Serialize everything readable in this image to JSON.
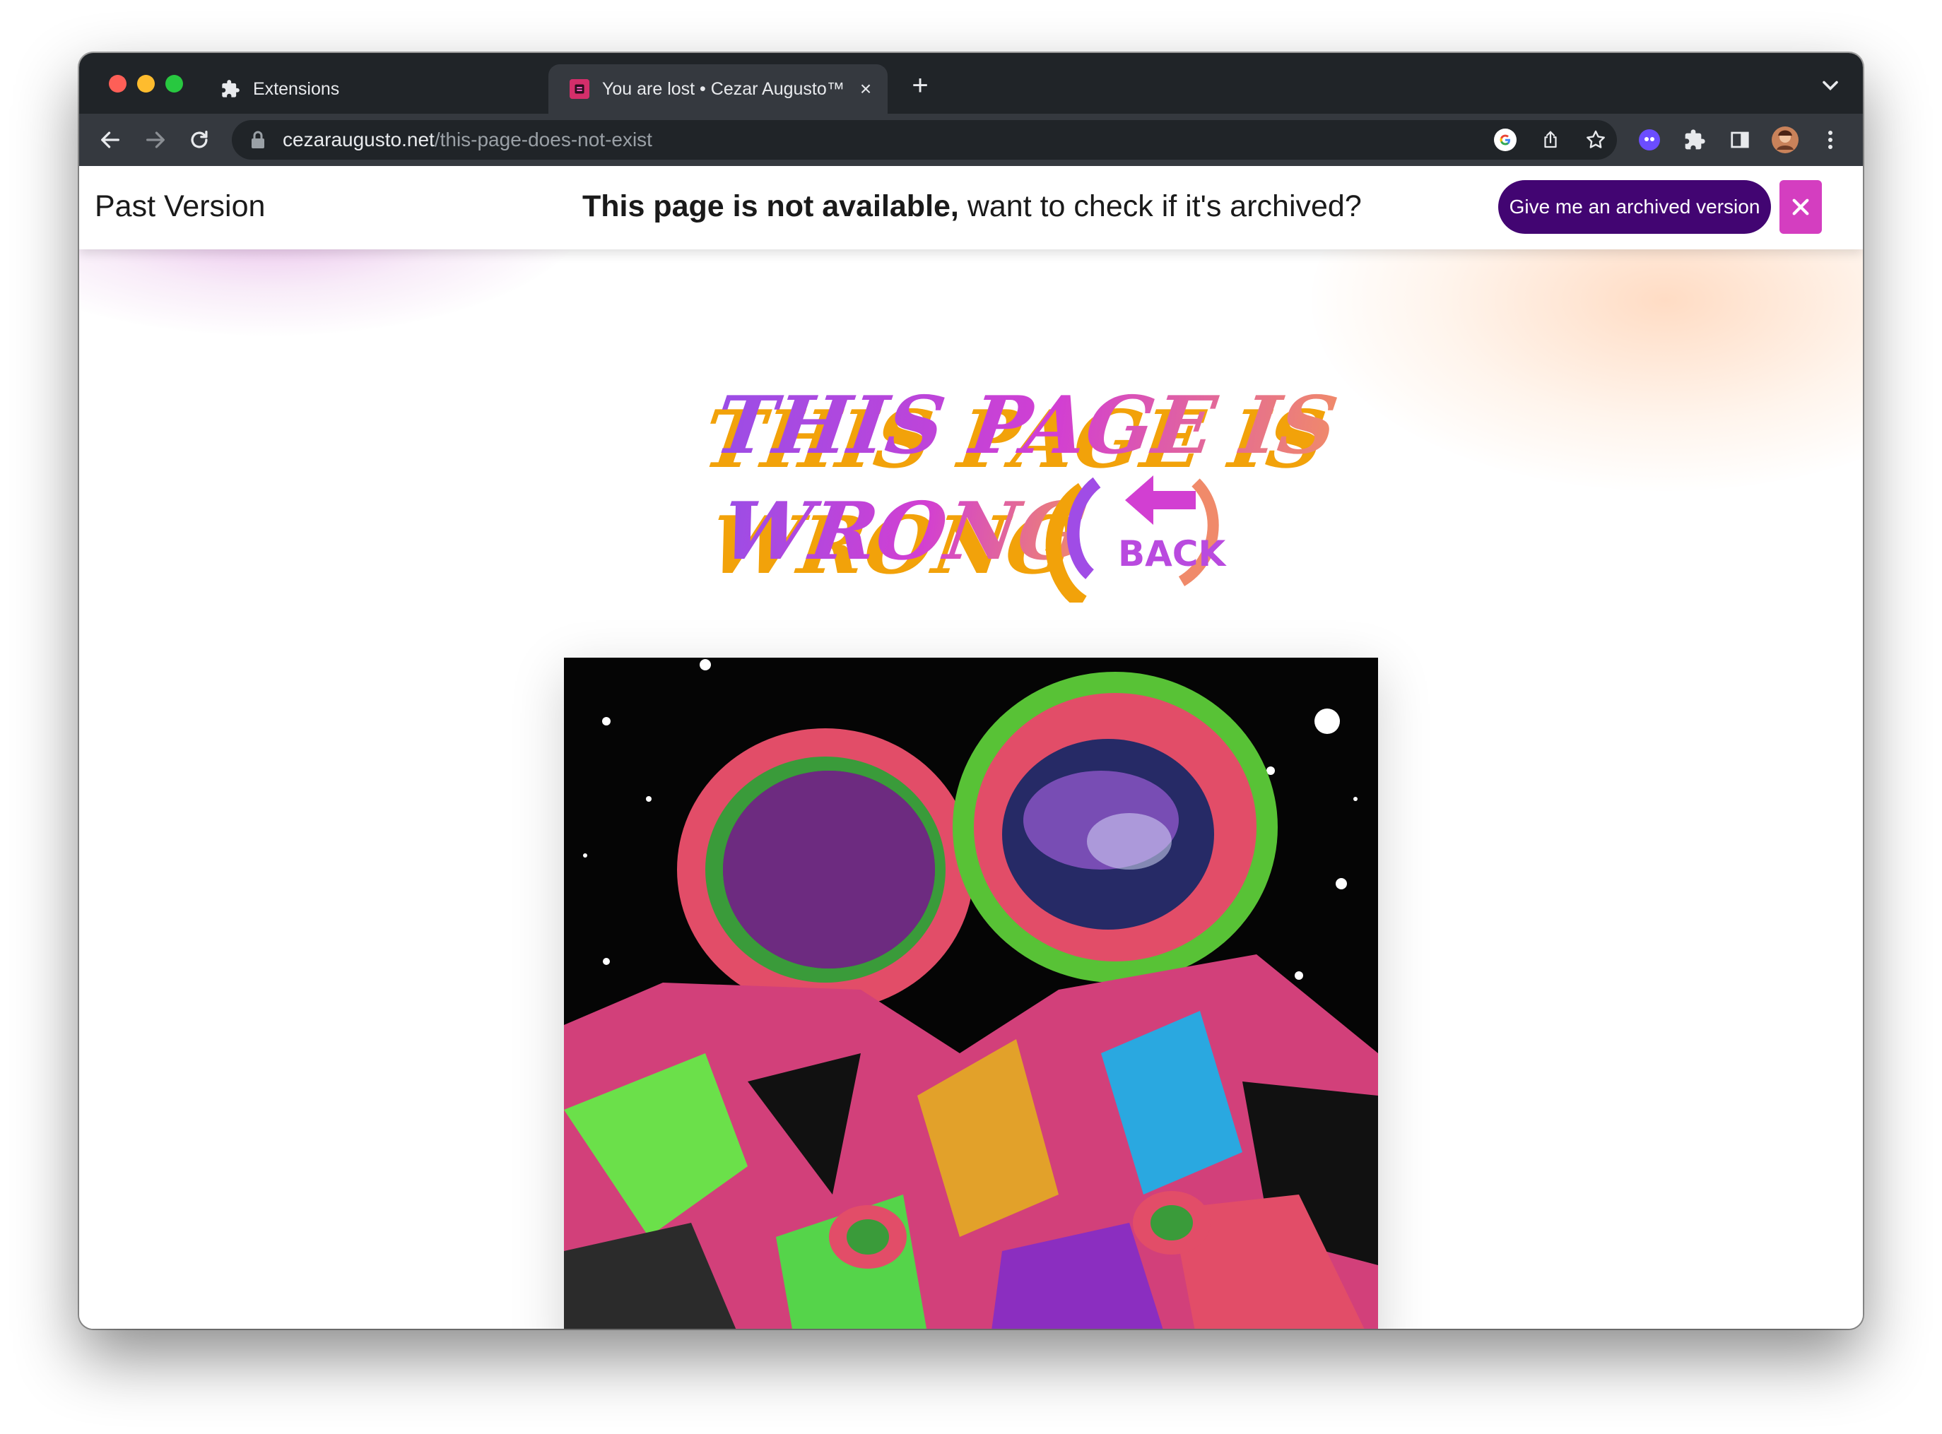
{
  "browser": {
    "tabs": [
      {
        "label": "Extensions",
        "icon": "puzzle-icon",
        "active": false
      },
      {
        "label": "You are lost • Cezar Augusto™",
        "icon": "favicon-icon",
        "active": true
      }
    ],
    "url": {
      "host": "cezaraugusto.net",
      "path": "/this-page-does-not-exist"
    }
  },
  "banner": {
    "left_label": "Past Version",
    "message_bold": "This page is not available,",
    "message_rest": " want to check if it's archived?",
    "archive_button_label": "Give me an archived version",
    "close_glyph": "✕"
  },
  "headline": {
    "line1": "THIS PAGE IS",
    "line2": "WRONG",
    "back_label": "BACK"
  },
  "colors": {
    "accent_purple": "#420572",
    "close_pink": "#d43ec0",
    "headline_magenta": "#b94adf",
    "headline_orange": "#f2a20a"
  }
}
